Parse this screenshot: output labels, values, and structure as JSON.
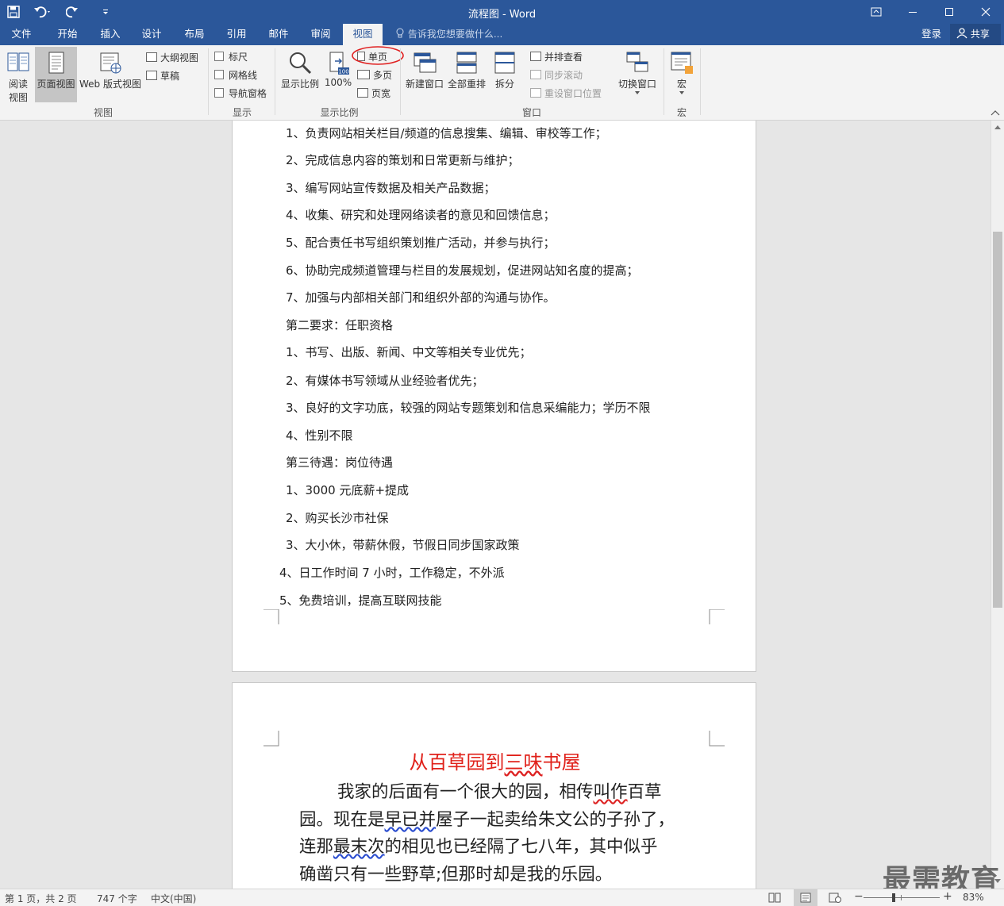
{
  "window": {
    "title": "流程图 - Word"
  },
  "tabs": [
    "文件",
    "开始",
    "插入",
    "设计",
    "布局",
    "引用",
    "邮件",
    "审阅",
    "视图"
  ],
  "active_tab": "视图",
  "tell_me": "告诉我您想要做什么...",
  "account": {
    "login": "登录",
    "share": "共享"
  },
  "ribbon": {
    "view_group": {
      "read": "阅读\n视图",
      "read_l1": "阅读",
      "read_l2": "视图",
      "print": "页面视图",
      "web": "Web 版式视图",
      "outline": "大纲视图",
      "draft": "草稿",
      "label": "视图"
    },
    "show_group": {
      "ruler": "标尺",
      "gridlines": "网格线",
      "nav": "导航窗格",
      "label": "显示"
    },
    "zoom_group": {
      "zoom": "显示比例",
      "hundred": "100%",
      "one_page": "单页",
      "multi_page": "多页",
      "page_width": "页宽",
      "label": "显示比例"
    },
    "window_group": {
      "new": "新建窗口",
      "arrange": "全部重排",
      "split": "拆分",
      "side_by_side": "并排查看",
      "sync_scroll": "同步滚动",
      "reset_pos": "重设窗口位置",
      "switch": "切换窗口",
      "label": "窗口"
    },
    "macro_group": {
      "macro": "宏",
      "label": "宏"
    },
    "hundred_icon_text": "100"
  },
  "page1_lines": [
    "1、负责网站相关栏目/频道的信息搜集、编辑、审校等工作；",
    "2、完成信息内容的策划和日常更新与维护；",
    "3、编写网站宣传数据及相关产品数据；",
    "4、收集、研究和处理网络读者的意见和回馈信息；",
    "5、配合责任书写组织策划推广活动，并参与执行；",
    "6、协助完成频道管理与栏目的发展规划，促进网站知名度的提高；",
    "7、加强与内部相关部门和组织外部的沟通与协作。",
    "第二要求：任职资格",
    "1、书写、出版、新闻、中文等相关专业优先；",
    "2、有媒体书写领域从业经验者优先；",
    "3、良好的文字功底，较强的网站专题策划和信息采编能力；学历不限",
    "4、性别不限",
    "第三待遇：岗位待遇",
    "1、3000 元底薪+提成",
    "2、购买长沙市社保",
    "3、大小休，带薪休假，节假日同步国家政策",
    "4、日工作时间 7 小时，工作稳定，不外派",
    "5、免费培训，提高互联网技能"
  ],
  "page2": {
    "heading_pre": "从百草园到",
    "heading_sq": "三味",
    "heading_post": "书屋",
    "p1_l1_pre": "我家的后面有一个很大的园，相传",
    "p1_l1_sq": "叫作",
    "p1_l1_post": "百草",
    "p1_l2_pre": "园。现在是",
    "p1_l2_sq": "早已并",
    "p1_l2_post": "屋子一起卖给朱文公的子孙了，",
    "p1_l3_pre": "连那",
    "p1_l3_sq": "最末次",
    "p1_l3_post": "的相见也已经隔了七八年，其中似乎",
    "p1_l4": "确凿只有一些野草;但那时却是我的乐园。"
  },
  "status": {
    "page": "第 1 页，共 2 页",
    "words": "747 个字",
    "lang": "中文(中国)",
    "zoom": "83%"
  },
  "watermark": "最需教育",
  "colors": {
    "brand": "#2b579a",
    "heading": "#e0211a",
    "highlight_circle": "#e02020"
  }
}
